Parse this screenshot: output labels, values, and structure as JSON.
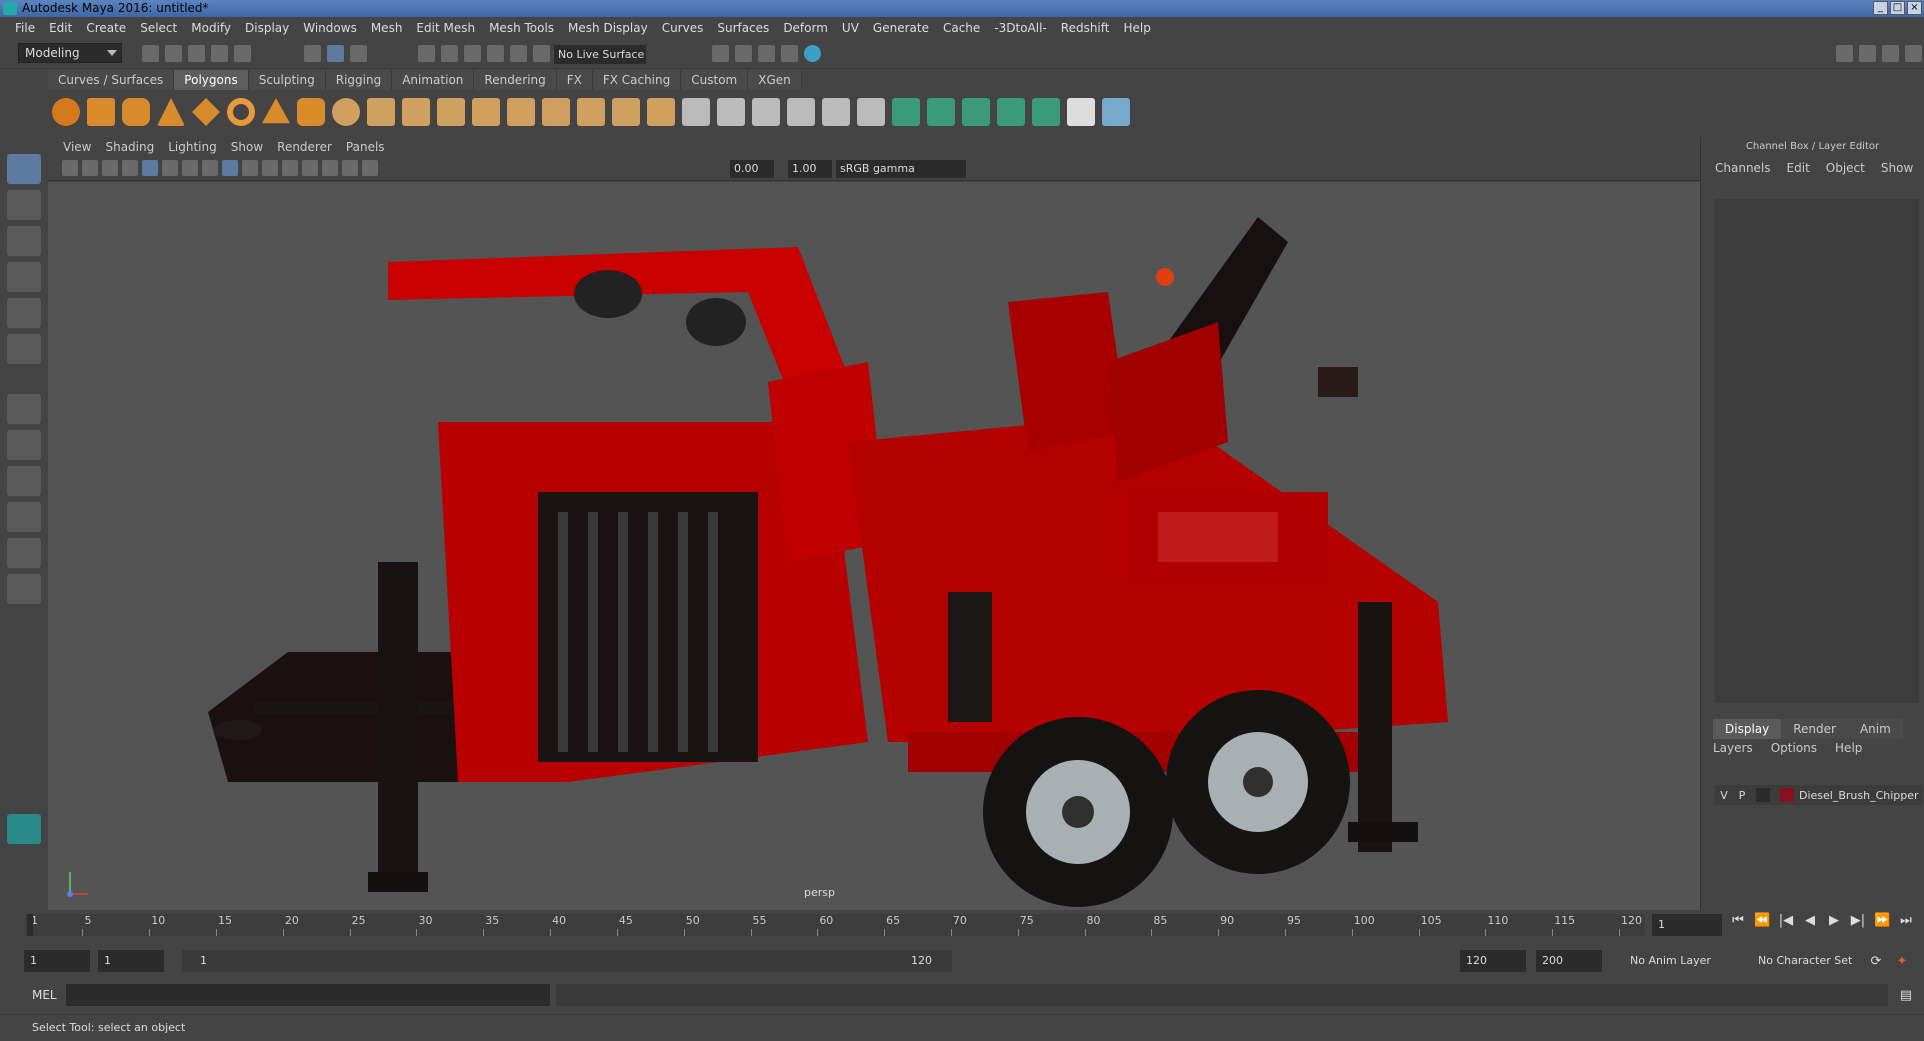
{
  "window": {
    "title": "Autodesk Maya 2016: untitled*"
  },
  "menubar": [
    "File",
    "Edit",
    "Create",
    "Select",
    "Modify",
    "Display",
    "Windows",
    "Mesh",
    "Edit Mesh",
    "Mesh Tools",
    "Mesh Display",
    "Curves",
    "Surfaces",
    "Deform",
    "UV",
    "Generate",
    "Cache",
    "-3DtoAll-",
    "Redshift",
    "Help"
  ],
  "statusline": {
    "mode": "Modeling",
    "live_surface": "No Live Surface"
  },
  "shelf": {
    "tabs": [
      "Curves / Surfaces",
      "Polygons",
      "Sculpting",
      "Rigging",
      "Animation",
      "Rendering",
      "FX",
      "FX Caching",
      "Custom",
      "XGen"
    ],
    "active_tab": "Polygons"
  },
  "viewport": {
    "menu": [
      "View",
      "Shading",
      "Lighting",
      "Show",
      "Renderer",
      "Panels"
    ],
    "exposure": "0.00",
    "gamma": "1.00",
    "colorspace": "sRGB gamma",
    "camera_label": "persp",
    "accent": "#d10000"
  },
  "channel_box": {
    "title": "Channel Box / Layer Editor",
    "menu": [
      "Channels",
      "Edit",
      "Object",
      "Show"
    ],
    "tabs": [
      "Display",
      "Render",
      "Anim"
    ],
    "layer_menu": [
      "Layers",
      "Options",
      "Help"
    ],
    "layer": {
      "v": "V",
      "p": "P",
      "name": "Diesel_Brush_Chipper"
    }
  },
  "timeline": {
    "ticks": [
      "1",
      "5",
      "10",
      "15",
      "20",
      "25",
      "30",
      "35",
      "40",
      "45",
      "50",
      "55",
      "60",
      "65",
      "70",
      "75",
      "80",
      "85",
      "90",
      "95",
      "100",
      "105",
      "110",
      "115",
      "120"
    ],
    "current_frame": "1"
  },
  "range": {
    "start": "1",
    "playback_start": "1",
    "slider_start": "1",
    "slider_end": "120",
    "playback_end": "120",
    "end": "200",
    "anim_layer": "No Anim Layer",
    "character_set": "No Character Set"
  },
  "mel": {
    "label": "MEL"
  },
  "help_line": "Select Tool: select an object"
}
